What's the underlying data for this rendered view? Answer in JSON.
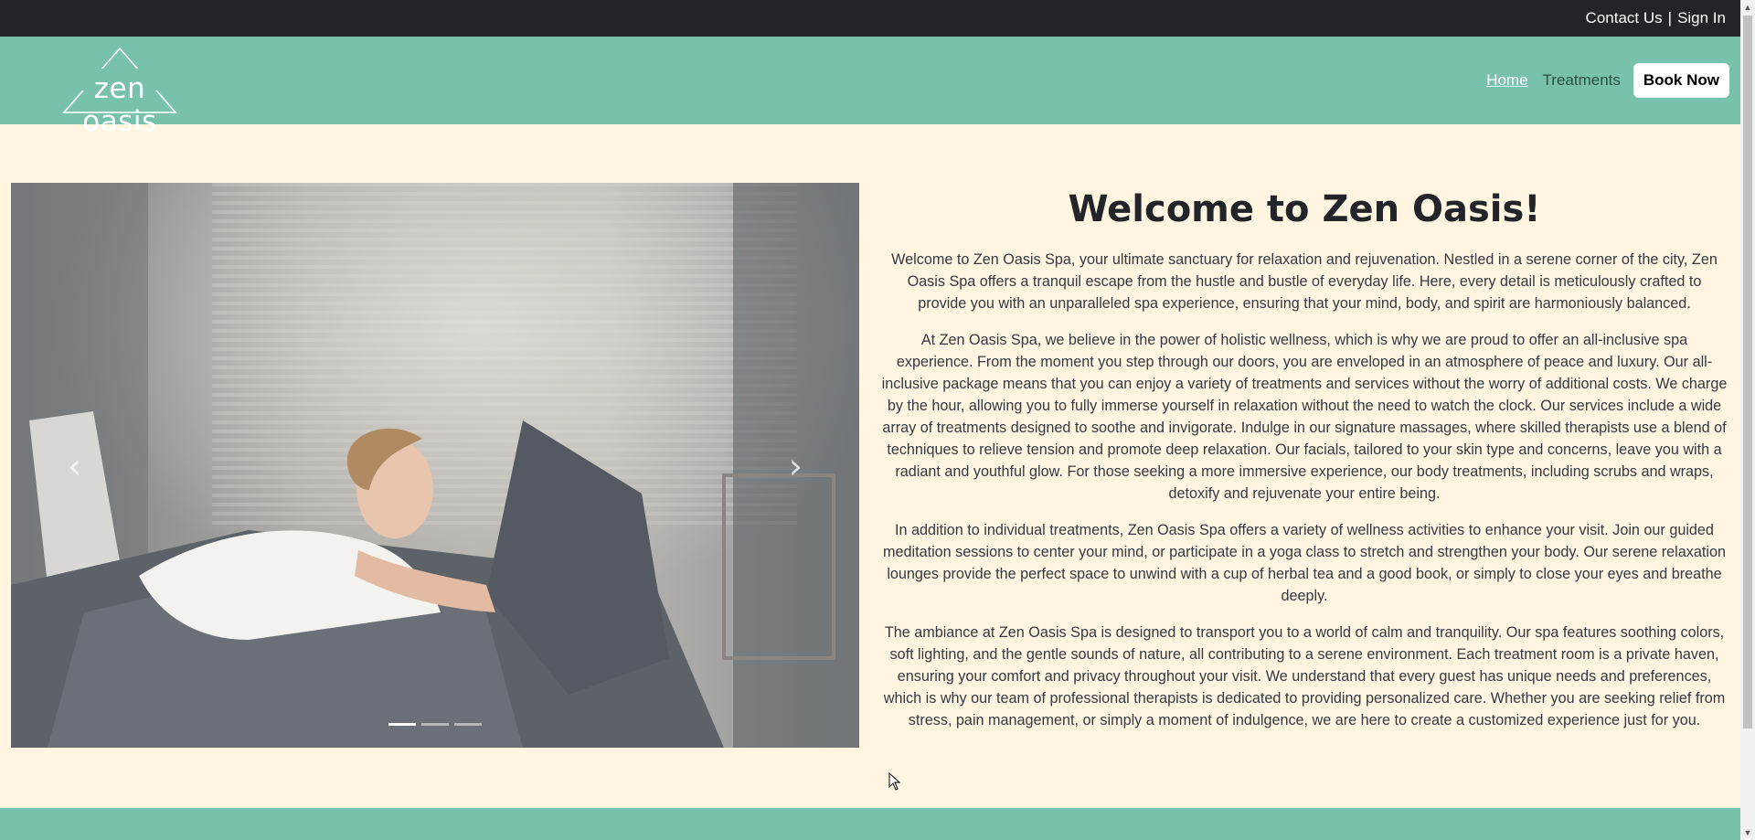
{
  "topbar": {
    "contact_label": "Contact Us",
    "separator": "|",
    "signin_label": "Sign In"
  },
  "navbar": {
    "logo_text": "zen oasis",
    "home_label": "Home",
    "treatments_label": "Treatments",
    "book_label": "Book Now"
  },
  "carousel": {
    "prev_icon": "chevron-left-icon",
    "next_icon": "chevron-right-icon",
    "prev_glyph": "‹",
    "next_glyph": "›",
    "active_slide": 1,
    "slide_count": 3
  },
  "main": {
    "heading": "Welcome to Zen Oasis!",
    "paragraphs": [
      "Welcome to Zen Oasis Spa, your ultimate sanctuary for relaxation and rejuvenation. Nestled in a serene corner of the city, Zen Oasis Spa offers a tranquil escape from the hustle and bustle of everyday life. Here, every detail is meticulously crafted to provide you with an unparalleled spa experience, ensuring that your mind, body, and spirit are harmoniously balanced.",
      "At Zen Oasis Spa, we believe in the power of holistic wellness, which is why we are proud to offer an all-inclusive spa experience. From the moment you step through our doors, you are enveloped in an atmosphere of peace and luxury. Our all-inclusive package means that you can enjoy a variety of treatments and services without the worry of additional costs. We charge by the hour, allowing you to fully immerse yourself in relaxation without the need to watch the clock. Our services include a wide array of treatments designed to soothe and invigorate. Indulge in our signature massages, where skilled therapists use a blend of techniques to relieve tension and promote deep relaxation. Our facials, tailored to your skin type and concerns, leave you with a radiant and youthful glow. For those seeking a more immersive experience, our body treatments, including scrubs and wraps, detoxify and rejuvenate your entire being.",
      "In addition to individual treatments, Zen Oasis Spa offers a variety of wellness activities to enhance your visit. Join our guided meditation sessions to center your mind, or participate in a yoga class to stretch and strengthen your body. Our serene relaxation lounges provide the perfect space to unwind with a cup of herbal tea and a good book, or simply to close your eyes and breathe deeply.",
      "The ambiance at Zen Oasis Spa is designed to transport you to a world of calm and tranquility. Our spa features soothing colors, soft lighting, and the gentle sounds of nature, all contributing to a serene environment. Each treatment room is a private haven, ensuring your comfort and privacy throughout your visit. We understand that every guest has unique needs and preferences, which is why our team of professional therapists is dedicated to providing personalized care. Whether you are seeking relief from stress, pain management, or simply a moment of indulgence, we are here to create a customized experience just for you."
    ]
  },
  "colors": {
    "topbar": "#212529",
    "brand": "#78c2ad",
    "page_bg": "#fff5e1"
  }
}
